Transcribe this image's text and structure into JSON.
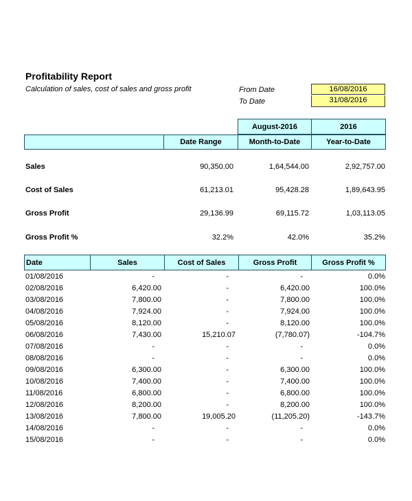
{
  "report": {
    "title": "Profitability Report",
    "subtitle": "Calculation of sales, cost of sales and gross profit",
    "from_label": "From Date",
    "from_value": "16/08/2016",
    "to_label": "To Date",
    "to_value": "31/08/2016"
  },
  "colors": {
    "header_fill": "#ccffff",
    "input_fill": "#ffff99"
  },
  "summary": {
    "header_top": [
      "August-2016",
      "2016"
    ],
    "header_bottom": [
      "Date Range",
      "Month-to-Date",
      "Year-to-Date"
    ],
    "rows": [
      {
        "label": "Sales",
        "range": "90,350.00",
        "mtd": "1,64,544.00",
        "ytd": "2,92,757.00"
      },
      {
        "label": "Cost of Sales",
        "range": "61,213.01",
        "mtd": "95,428.28",
        "ytd": "1,89,643.95"
      },
      {
        "label": "Gross Profit",
        "range": "29,136.99",
        "mtd": "69,115.72",
        "ytd": "1,03,113.05"
      },
      {
        "label": "Gross Profit %",
        "range": "32.2%",
        "mtd": "42.0%",
        "ytd": "35.2%"
      }
    ]
  },
  "daily": {
    "headers": [
      "Date",
      "Sales",
      "Cost of Sales",
      "Gross Profit",
      "Gross Profit %"
    ],
    "rows": [
      {
        "date": "01/08/2016",
        "sales": "-",
        "cost": "-",
        "gp": "-",
        "pct": "0.0%"
      },
      {
        "date": "02/08/2016",
        "sales": "6,420.00",
        "cost": "-",
        "gp": "6,420.00",
        "pct": "100.0%"
      },
      {
        "date": "03/08/2016",
        "sales": "7,800.00",
        "cost": "-",
        "gp": "7,800.00",
        "pct": "100.0%"
      },
      {
        "date": "04/08/2016",
        "sales": "7,924.00",
        "cost": "-",
        "gp": "7,924.00",
        "pct": "100.0%"
      },
      {
        "date": "05/08/2016",
        "sales": "8,120.00",
        "cost": "-",
        "gp": "8,120.00",
        "pct": "100.0%"
      },
      {
        "date": "06/08/2016",
        "sales": "7,430.00",
        "cost": "15,210.07",
        "gp": "(7,780.07)",
        "pct": "-104.7%"
      },
      {
        "date": "07/08/2016",
        "sales": "-",
        "cost": "-",
        "gp": "-",
        "pct": "0.0%"
      },
      {
        "date": "08/08/2016",
        "sales": "-",
        "cost": "-",
        "gp": "-",
        "pct": "0.0%"
      },
      {
        "date": "09/08/2016",
        "sales": "6,300.00",
        "cost": "-",
        "gp": "6,300.00",
        "pct": "100.0%"
      },
      {
        "date": "10/08/2016",
        "sales": "7,400.00",
        "cost": "-",
        "gp": "7,400.00",
        "pct": "100.0%"
      },
      {
        "date": "11/08/2016",
        "sales": "6,800.00",
        "cost": "-",
        "gp": "6,800.00",
        "pct": "100.0%"
      },
      {
        "date": "12/08/2016",
        "sales": "8,200.00",
        "cost": "-",
        "gp": "8,200.00",
        "pct": "100.0%"
      },
      {
        "date": "13/08/2016",
        "sales": "7,800.00",
        "cost": "19,005.20",
        "gp": "(11,205.20)",
        "pct": "-143.7%"
      },
      {
        "date": "14/08/2016",
        "sales": "-",
        "cost": "-",
        "gp": "-",
        "pct": "0.0%"
      },
      {
        "date": "15/08/2016",
        "sales": "-",
        "cost": "-",
        "gp": "-",
        "pct": "0.0%"
      }
    ]
  }
}
